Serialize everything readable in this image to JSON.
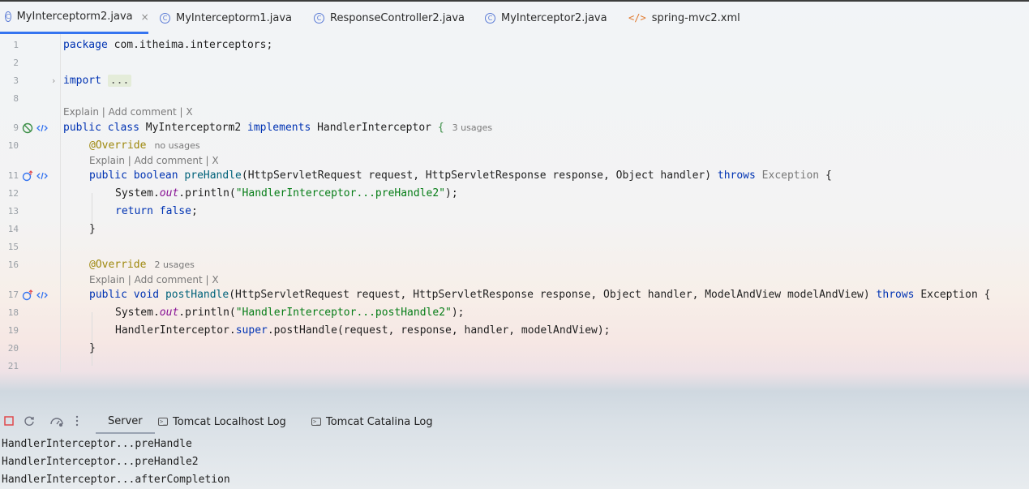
{
  "tabs": [
    {
      "label": "MyInterceptorm2.java",
      "icon": "class-icon",
      "active": true,
      "close": "×"
    },
    {
      "label": "MyInterceptorm1.java",
      "icon": "class-icon"
    },
    {
      "label": "ResponseController2.java",
      "icon": "class-icon"
    },
    {
      "label": "MyInterceptor2.java",
      "icon": "class-icon"
    },
    {
      "label": "spring-mvc2.xml",
      "icon": "xml-icon"
    }
  ],
  "editor": {
    "line_numbers": [
      "1",
      "2",
      "3",
      "8",
      "9",
      "10",
      "11",
      "12",
      "13",
      "14",
      "15",
      "16",
      "17",
      "18",
      "19",
      "20",
      "21"
    ],
    "code": {
      "l1_kw": "package",
      "l1_rest": " com.itheima.interceptors;",
      "l3_kw": "import",
      "l3_fold": "...",
      "l9_kw1": "public",
      "l9_kw2": "class",
      "l9_name": " MyInterceptorm2 ",
      "l9_kw3": "implements",
      "l9_rest": " HandlerInterceptor ",
      "l9_brace": "{",
      "l9_hint": "3 usages",
      "l10_ann": "@Override",
      "l10_hint": "no usages",
      "l11_kw1": "public",
      "l11_kw2": "boolean",
      "l11_meth": "preHandle",
      "l11_params": "(HttpServletRequest request, HttpServletResponse response, Object handler) ",
      "l11_throws": "throws",
      "l11_exc": " Exception",
      "l11_brace": " {",
      "l12_a": "System.",
      "l12_out": "out",
      "l12_b": ".println(",
      "l12_str": "\"HandlerInterceptor...preHandle2\"",
      "l12_c": ");",
      "l13_kw1": "return",
      "l13_kw2": "false",
      "l13_c": ";",
      "l14": "}",
      "l16_ann": "@Override",
      "l16_hint": "2 usages",
      "l17_kw1": "public",
      "l17_kw2": "void",
      "l17_meth": "postHandle",
      "l17_params": "(HttpServletRequest request, HttpServletResponse response, Object handler, ModelAndView modelAndView) ",
      "l17_throws": "throws",
      "l17_exc": " Exception {",
      "l18_a": "System.",
      "l18_out": "out",
      "l18_b": ".println(",
      "l18_str": "\"HandlerInterceptor...postHandle2\"",
      "l18_c": ");",
      "l19_a": "HandlerInterceptor.",
      "l19_super": "super",
      "l19_b": ".postHandle(request, response, handler, modelAndView);",
      "l20": "}"
    },
    "explain_label": "Explain | Add comment | X"
  },
  "run_toolbar": {
    "tabs": [
      {
        "label": "Server",
        "active": true
      },
      {
        "label": "Tomcat Localhost Log",
        "icon": "terminal-icon"
      },
      {
        "label": "Tomcat Catalina Log",
        "icon": "terminal-icon"
      }
    ],
    "buttons": [
      "stop-icon",
      "rerun-icon",
      "dashboard-icon",
      "more-icon"
    ]
  },
  "console": [
    "HandlerInterceptor...preHandle",
    "HandlerInterceptor...preHandle2",
    "HandlerInterceptor...afterCompletion"
  ],
  "colors": {
    "accent": "#3574f0",
    "keyword": "#0033b3",
    "string": "#067d17",
    "annotation": "#9e880d",
    "stop": "#e0484b"
  }
}
